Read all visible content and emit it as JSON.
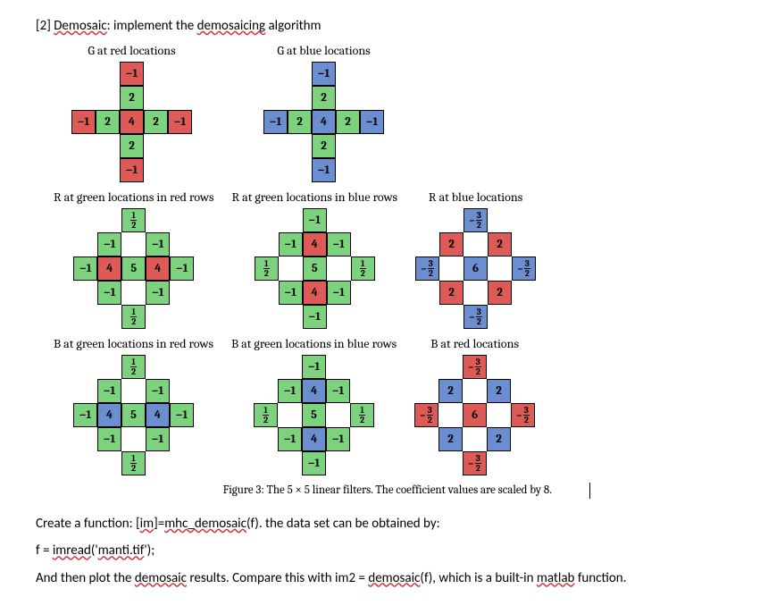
{
  "heading_prefix": "[2] ",
  "heading_sq1": "Demosaic",
  "heading_mid": ": implement the ",
  "heading_sq2": "demosaicing",
  "heading_suffix": " algorithm",
  "titles": {
    "g_red": "G at red locations",
    "g_blue": "G at blue locations",
    "r_gr": "R at green locations in red rows",
    "r_gb": "R at green locations in blue rows",
    "r_b": "R at blue locations",
    "b_gr": "B at green locations in red rows",
    "b_gb": "B at green locations in blue rows",
    "b_r": "B at red locations"
  },
  "caption": "Figure 3: The 5 × 5 linear filters. The coefficient values are scaled by 8.",
  "p1_a": "Create a function: [",
  "p1_b": "im",
  "p1_c": "]=",
  "p1_d": "mhc_demosaic",
  "p1_e": "(f). the data set can be obtained by:",
  "p2_a": "f = ",
  "p2_b": "imread",
  "p2_c": "('",
  "p2_d": "manti.tif",
  "p2_e": "');",
  "p3_a": "And then plot the ",
  "p3_b": "demosaic",
  "p3_c": " results. Compare this with im2 = ",
  "p3_d": "demosaic",
  "p3_e": "(f), which is a built-in ",
  "p3_f": "matlab",
  "p3_g": " function.",
  "filters": {
    "g_red": [
      [
        "",
        "",
        "-1/red",
        "",
        ""
      ],
      [
        "",
        "",
        "2/green",
        "",
        ""
      ],
      [
        "-1/red",
        "2/green",
        "4/red",
        "2/green",
        "-1/red"
      ],
      [
        "",
        "",
        "2/green",
        "",
        ""
      ],
      [
        "",
        "",
        "-1/red",
        "",
        ""
      ]
    ],
    "g_blue": [
      [
        "",
        "",
        "-1/blue",
        "",
        ""
      ],
      [
        "",
        "",
        "2/green",
        "",
        ""
      ],
      [
        "-1/blue",
        "2/green",
        "4/blue",
        "2/green",
        "-1/blue"
      ],
      [
        "",
        "",
        "2/green",
        "",
        ""
      ],
      [
        "",
        "",
        "-1/blue",
        "",
        ""
      ]
    ],
    "r_gr": [
      [
        "",
        "",
        "f1_2/green",
        "",
        ""
      ],
      [
        "",
        "-1/green",
        "",
        "-1/green",
        ""
      ],
      [
        "-1/green",
        "4/red",
        "5/green",
        "4/red",
        "-1/green"
      ],
      [
        "",
        "-1/green",
        "",
        "-1/green",
        ""
      ],
      [
        "",
        "",
        "f1_2/green",
        "",
        ""
      ]
    ],
    "r_gb": [
      [
        "",
        "",
        "-1/green",
        "",
        ""
      ],
      [
        "",
        "-1/green",
        "4/red",
        "-1/green",
        ""
      ],
      [
        "f1_2/green",
        "",
        "5/green",
        "",
        "f1_2/green"
      ],
      [
        "",
        "-1/green",
        "4/red",
        "-1/green",
        ""
      ],
      [
        "",
        "",
        "-1/green",
        "",
        ""
      ]
    ],
    "r_b": [
      [
        "",
        "",
        "f-3_2/blue",
        "",
        ""
      ],
      [
        "",
        "2/red",
        "",
        "2/red",
        ""
      ],
      [
        "f-3_2/blue",
        "",
        "6/blue",
        "",
        "f-3_2/blue"
      ],
      [
        "",
        "2/red",
        "",
        "2/red",
        ""
      ],
      [
        "",
        "",
        "f-3_2/blue",
        "",
        ""
      ]
    ],
    "b_gr": [
      [
        "",
        "",
        "f1_2/green",
        "",
        ""
      ],
      [
        "",
        "-1/green",
        "",
        "-1/green",
        ""
      ],
      [
        "-1/green",
        "4/blue",
        "5/green",
        "4/blue",
        "-1/green"
      ],
      [
        "",
        "-1/green",
        "",
        "-1/green",
        ""
      ],
      [
        "",
        "",
        "f1_2/green",
        "",
        ""
      ]
    ],
    "b_gb": [
      [
        "",
        "",
        "-1/green",
        "",
        ""
      ],
      [
        "",
        "-1/green",
        "4/blue",
        "-1/green",
        ""
      ],
      [
        "f1_2/green",
        "",
        "5/green",
        "",
        "f1_2/green"
      ],
      [
        "",
        "-1/green",
        "4/blue",
        "-1/green",
        ""
      ],
      [
        "",
        "",
        "-1/green",
        "",
        ""
      ]
    ],
    "b_r": [
      [
        "",
        "",
        "f-3_2/red",
        "",
        ""
      ],
      [
        "",
        "2/blue",
        "",
        "2/blue",
        ""
      ],
      [
        "f-3_2/red",
        "",
        "6/red",
        "",
        "f-3_2/red"
      ],
      [
        "",
        "2/blue",
        "",
        "2/blue",
        ""
      ],
      [
        "",
        "",
        "f-3_2/red",
        "",
        ""
      ]
    ]
  }
}
